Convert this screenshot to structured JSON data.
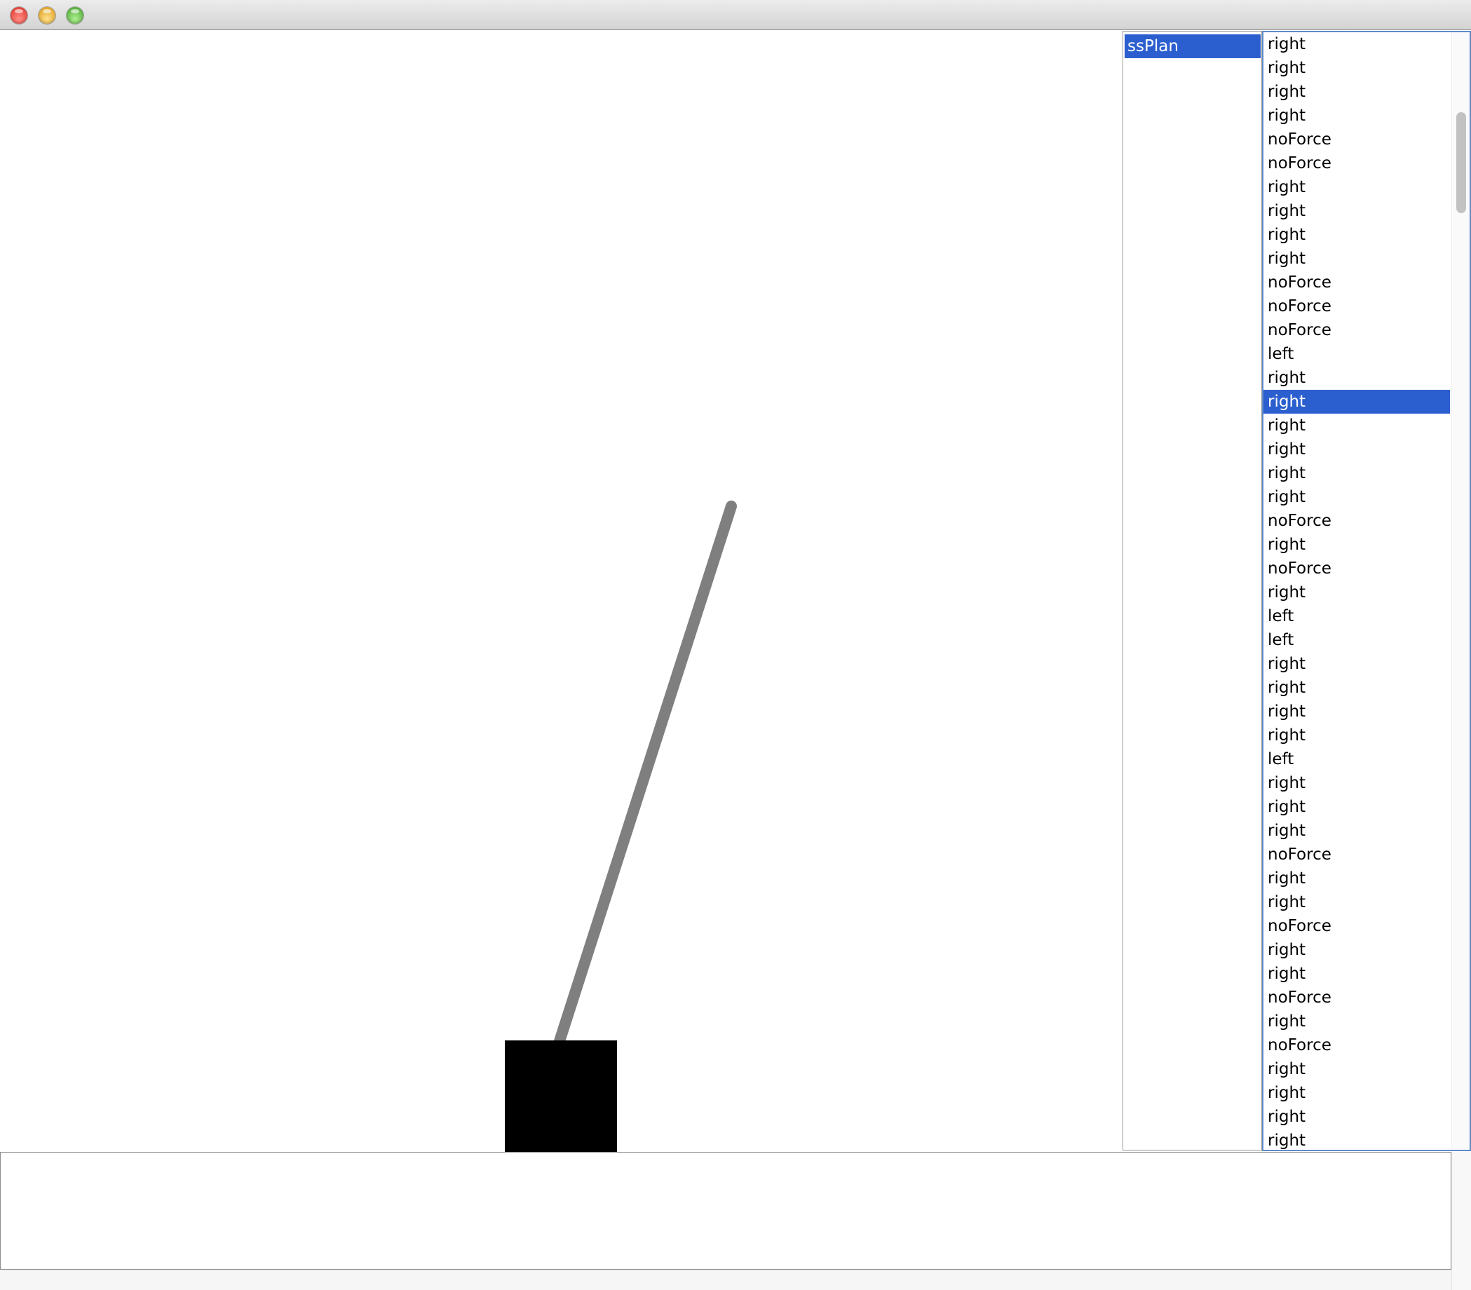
{
  "window": {
    "title": ""
  },
  "plan_list": {
    "items": [
      {
        "label": "ssPlan",
        "selected": true
      }
    ]
  },
  "action_list": {
    "selected_index": 15,
    "items": [
      "right",
      "right",
      "right",
      "right",
      "noForce",
      "noForce",
      "right",
      "right",
      "right",
      "right",
      "noForce",
      "noForce",
      "noForce",
      "left",
      "right",
      "right",
      "right",
      "right",
      "right",
      "right",
      "noForce",
      "right",
      "noForce",
      "right",
      "left",
      "left",
      "right",
      "right",
      "right",
      "right",
      "left",
      "right",
      "right",
      "right",
      "noForce",
      "right",
      "right",
      "noForce",
      "right",
      "right",
      "noForce",
      "right",
      "noForce",
      "right",
      "right",
      "right",
      "right"
    ]
  },
  "simulation": {
    "cart_color": "#000000",
    "pole_color": "#7f7f7f"
  },
  "colors": {
    "selection": "#2b5fcf",
    "list_border": "#5f8ac8"
  }
}
